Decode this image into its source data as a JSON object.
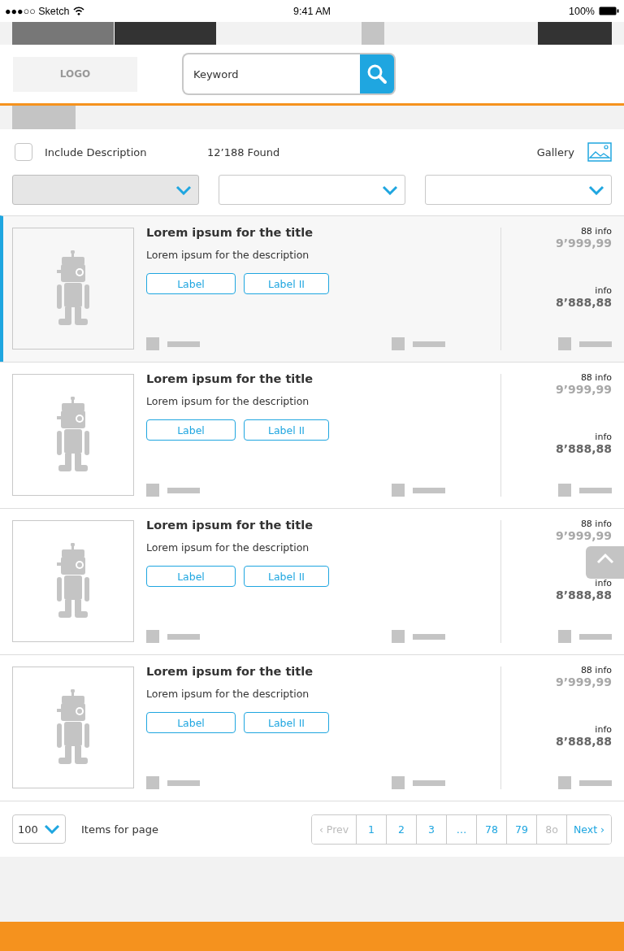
{
  "status_bar": {
    "carrier": "●●●○○ Sketch",
    "time": "9:41 AM",
    "battery": "100%"
  },
  "header": {
    "logo": "LOGO",
    "search": {
      "value": "Keyword"
    }
  },
  "filters": {
    "include_description": {
      "label": "Include Description",
      "checked": false
    },
    "found": "12’188 Found",
    "view": "Gallery",
    "dropdowns": [
      {
        "disabled": true
      },
      {
        "disabled": false
      },
      {
        "disabled": false
      }
    ]
  },
  "results": [
    {
      "title": "Lorem ipsum for the title",
      "description": "Lorem ipsum for the description",
      "labels": [
        "Label",
        "Label II"
      ],
      "info_1": "88 info",
      "old_price": "9’999,99",
      "info_2": "info",
      "price": "8’888,88",
      "selected": true
    },
    {
      "title": "Lorem ipsum for the title",
      "description": "Lorem ipsum for the description",
      "labels": [
        "Label",
        "Label II"
      ],
      "info_1": "88 info",
      "old_price": "9’999,99",
      "info_2": "info",
      "price": "8’888,88",
      "selected": false
    },
    {
      "title": "Lorem ipsum for the title",
      "description": "Lorem ipsum for the description",
      "labels": [
        "Label",
        "Label II"
      ],
      "info_1": "88 info",
      "old_price": "9’999,99",
      "info_2": "info",
      "price": "8’888,88",
      "selected": false
    },
    {
      "title": "Lorem ipsum for the title",
      "description": "Lorem ipsum for the description",
      "labels": [
        "Label",
        "Label II"
      ],
      "info_1": "88 info",
      "old_price": "9’999,99",
      "info_2": "info",
      "price": "8’888,88",
      "selected": false
    }
  ],
  "footer": {
    "page_size": "100",
    "page_size_label": "Items for page",
    "pages": [
      {
        "label": "‹ Prev",
        "disabled": true
      },
      {
        "label": "1",
        "disabled": false
      },
      {
        "label": "2",
        "disabled": false
      },
      {
        "label": "3",
        "disabled": false
      },
      {
        "label": "…",
        "disabled": false
      },
      {
        "label": "78",
        "disabled": false
      },
      {
        "label": "79",
        "disabled": false
      },
      {
        "label": "8o",
        "disabled": true
      },
      {
        "label": "Next ›",
        "disabled": false
      }
    ]
  }
}
